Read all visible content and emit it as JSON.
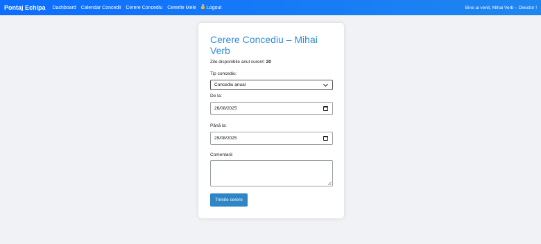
{
  "navbar": {
    "brand": "Pontaj Echipa",
    "links": [
      "Dashboard",
      "Calendar Concedii",
      "Cerere Concediu",
      "Cererile Mele"
    ],
    "logout": "Logout",
    "welcome": "Bine ai venit, Mihai Verb – Director !"
  },
  "form": {
    "title": "Cerere Concediu – Mihai Verb",
    "available_label": "Zile disponibile anul curent:",
    "available_value": "20",
    "type_label": "Tip concediu:",
    "type_value": "Concediu anual",
    "from_label": "De la:",
    "from_value": "26/08/2025",
    "to_label": "Până la:",
    "to_value": "29/08/2025",
    "comments_label": "Comentarii:",
    "submit_label": "Trimite cerere"
  }
}
